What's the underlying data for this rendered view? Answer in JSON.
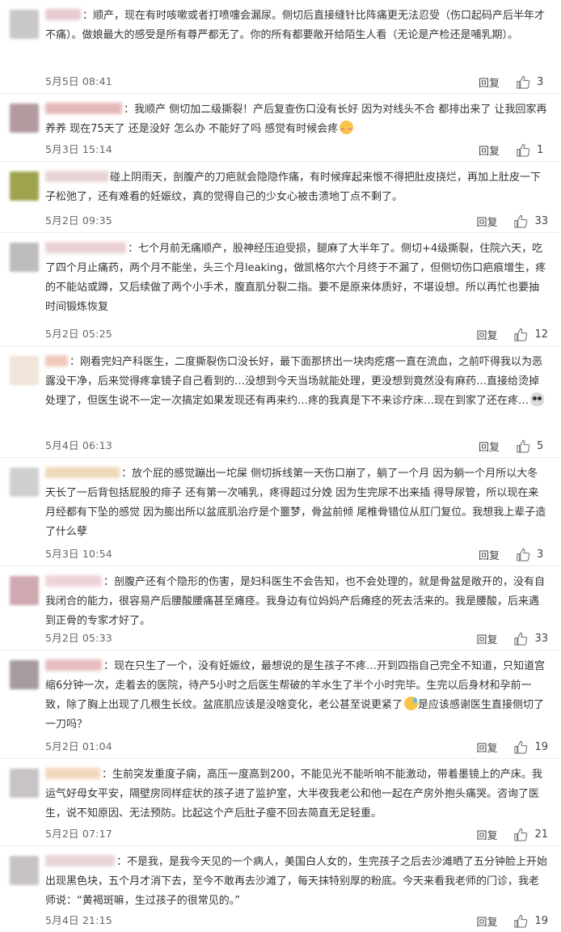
{
  "comments": [
    {
      "username_color": "#e8c9cf",
      "avatar_color": "#c9c7c8",
      "text": "顺产，现在有时咳嗽或者打喷嚏会漏尿。侧切后直接缝针比阵痛更无法忍受（伤口起码产后半年才不痛）。做娘最大的感受是所有尊严都无了。你的所有都要敞开给陌生人看（无论是产检还是哺乳期）。",
      "emoji": "",
      "date": "5月5日 08:41",
      "reply_label": "回复",
      "likes": "3"
    },
    {
      "username_color": "#e6b8b8",
      "avatar_color": "#b39a9f",
      "text": "我顺产 侧切加二级撕裂！产后复查伤口没有长好 因为对线头不合 都排出来了 让我回家再养养 现在75天了 还是没好 怎么办 不能好了吗  感觉有时候会疼",
      "emoji": "blush",
      "date": "5月3日 15:14",
      "reply_label": "回复",
      "likes": "1"
    },
    {
      "username_color": "#e9d2d4",
      "avatar_color": "#9ea34d",
      "text": "碰上阴雨天，剖腹产的刀疤就会隐隐作痛，有时候痒起来恨不得把肚皮挠烂，再加上肚皮一下子松弛了，还有难看的妊娠纹，真的觉得自己的少女心被击溃地丁点不剩了。",
      "emoji": "",
      "date": "5月2日 09:35",
      "reply_label": "回复",
      "likes": "33"
    },
    {
      "username_color": "#ead0d3",
      "avatar_color": "#bdbbbe",
      "text": "七个月前无痛顺产，股神经压迫受损，腿麻了大半年了。侧切+4级撕裂，住院六天，吃了四个月止痛药，两个月不能坐，头三个月leaking，做凯格尔六个月终于不漏了，但侧切伤口疤痕增生，疼的不能站或蹲，又后续做了两个小手术，腹直肌分裂二指。要不是原来体质好，不堪设想。所以再忙也要抽时间锻炼恢复",
      "emoji": "",
      "date": "5月2日 05:25",
      "reply_label": "回复",
      "likes": "12"
    },
    {
      "username_color": "#f0c9bb",
      "avatar_color": "#f2e4d8",
      "text": "刚看完妇产科医生，二度撕裂伤口没长好，最下面那挤出一块肉疙瘩一直在流血，之前吓得我以为恶露没干净，后来觉得疼拿镜子自己看到的…没想到今天当场就能处理，更没想到竟然没有麻药…直接给烫掉处理了，但医生说不一定一次搞定如果发现还有再来约…疼的我真是下不来诊疗床…现在到家了还在疼…",
      "emoji": "skull",
      "date": "5月4日 06:13",
      "reply_label": "回复",
      "likes": "5"
    },
    {
      "username_color": "#eed9b8",
      "avatar_color": "#d0cfd0",
      "text": "放个屁的感觉蹦出一坨屎 侧切拆线第一天伤口崩了，躺了一个月 因为躺一个月所以大冬天长了一后背包括屁股的痱子 还有第一次哺乳，疼得超过分娩 因为生完尿不出来插 得导尿管，所以现在来月经都有下坠的感觉 因为膨出所以盆底肌治疗是个噩梦，骨盆前倾 尾椎骨错位从肛门复位。我想我上辈子造了什么孽",
      "emoji": "",
      "date": "5月3日 10:54",
      "reply_label": "回复",
      "likes": "3"
    },
    {
      "username_color": "#eed3d6",
      "avatar_color": "#cfa9b0",
      "text": "剖腹产还有个隐形的伤害，是妇科医生不会告知，也不会处理的，就是骨盆是敞开的，没有自我闭合的能力，很容易产后腰酸腰痛甚至瘫痉。我身边有位妈妈产后瘫痉的死去活来的。我是腰酸，后来遇到正骨的专家才好了。",
      "emoji": "",
      "date": "5月2日 05:33",
      "reply_label": "回复",
      "likes": "33"
    },
    {
      "username_color": "#e8bcc0",
      "avatar_color": "#a69ca0",
      "text": "现在只生了一个，没有妊娠纹，最想说的是生孩子不疼…开到四指自己完全不知道，只知道宫缩6分钟一次，走着去的医院，待产5小时之后医生帮破的羊水生了半个小时完毕。生完以后身材和孕前一致，除了胸上出现了几根生长纹。盆底肌应该是没啥变化，老公甚至说更紧了",
      "emoji": "sweat",
      "text_after": "是应该感谢医生直接侧切了一刀吗？",
      "date": "5月2日 01:04",
      "reply_label": "回复",
      "likes": "19"
    },
    {
      "username_color": "#f2d7bf",
      "avatar_color": "#c8c3c6",
      "text": "生前突发重度子痫，高压一度高到200，不能见光不能听响不能激动，带着墨镜上的产床。我运气好母女平安，隔壁房同样症状的孩子进了监护室，大半夜我老公和他一起在产房外抱头痛哭。咨询了医生，说不知原因、无法预防。比起这个产后肚子瘦不回去简直无足轻重。",
      "emoji": "",
      "date": "5月2日 07:17",
      "reply_label": "回复",
      "likes": "21"
    },
    {
      "username_color": "#ead4d7",
      "avatar_color": "#c7c2c5",
      "text": "不是我，是我今天见的一个病人，美国白人女的，生完孩子之后去沙滩晒了五分钟脸上开始出现黑色块，五个月才消下去，至今不敢再去沙滩了，每天抹特别厚的粉底。今天来看我老师的门诊，我老师说：“黄褐斑嘛，生过孩子的很常见的。”",
      "emoji": "",
      "date": "5月4日 21:15",
      "reply_label": "回复",
      "likes": "19"
    }
  ]
}
